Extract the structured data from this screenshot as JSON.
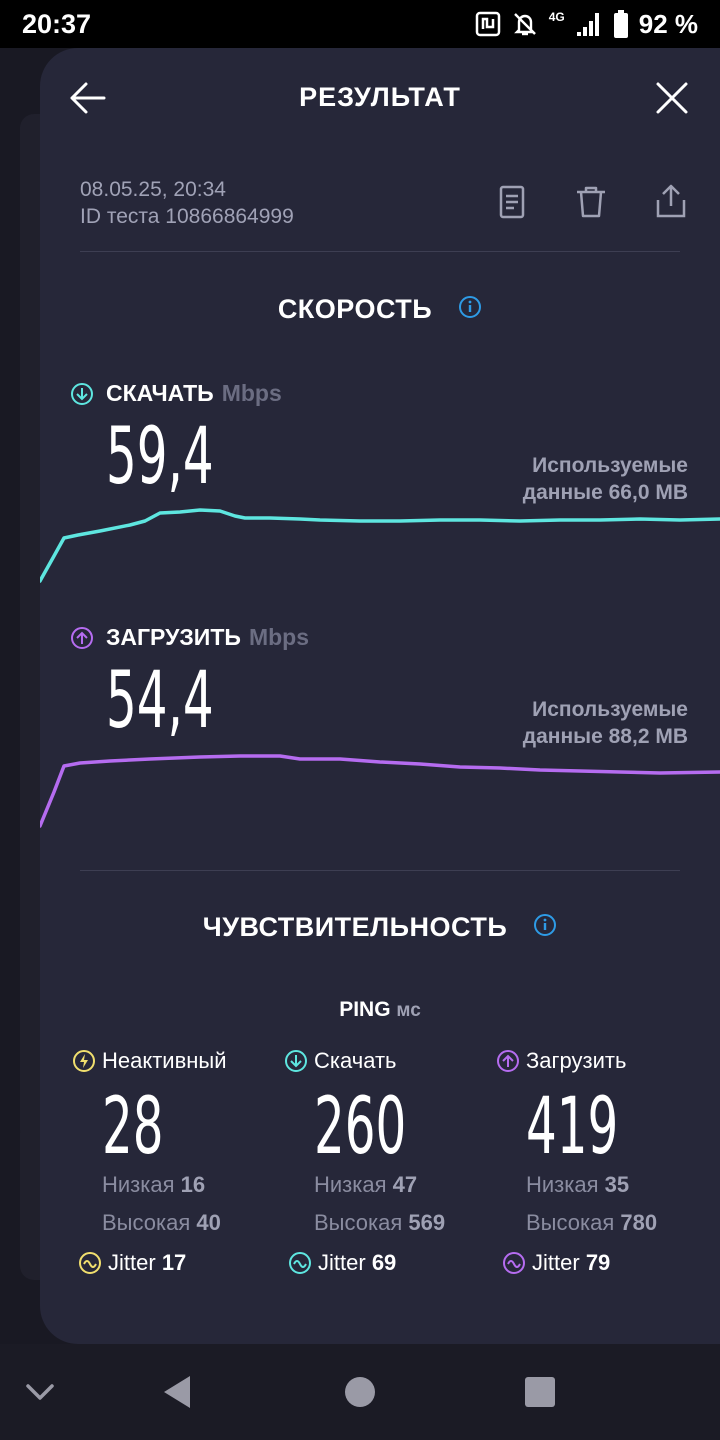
{
  "status_bar": {
    "time": "20:37",
    "network": "4G",
    "battery": "92 %"
  },
  "header": {
    "title": "РЕЗУЛЬТАТ"
  },
  "meta": {
    "datetime": "08.05.25, 20:34",
    "test_id": "ID теста 10866864999"
  },
  "speed": {
    "title": "СКОРОСТЬ",
    "download": {
      "label": "СКАЧАТЬ",
      "unit": "Mbps",
      "value": "59,4",
      "used_line1": "Используемые",
      "used_line2": "данные 66,0 MB"
    },
    "upload": {
      "label": "ЗАГРУЗИТЬ",
      "unit": "Mbps",
      "value": "54,4",
      "used_line1": "Используемые",
      "used_line2": "данные 88,2 MB"
    }
  },
  "latency": {
    "title": "ЧУВСТВИТЕЛЬНОСТЬ",
    "ping_label": "PING",
    "ping_unit": "мс",
    "idle": {
      "label": "Неактивный",
      "value": "28",
      "low_label": "Низкая",
      "low": "16",
      "high_label": "Высокая",
      "high": "40",
      "jitter_label": "Jitter",
      "jitter": "17"
    },
    "download": {
      "label": "Скачать",
      "value": "260",
      "low_label": "Низкая",
      "low": "47",
      "high_label": "Высокая",
      "high": "569",
      "jitter_label": "Jitter",
      "jitter": "69"
    },
    "upload": {
      "label": "Загрузить",
      "value": "419",
      "low_label": "Низкая",
      "low": "35",
      "high_label": "Высокая",
      "high": "780",
      "jitter_label": "Jitter",
      "jitter": "79"
    }
  },
  "colors": {
    "download": "#5ee6e0",
    "upload": "#b56cf0",
    "idle": "#f1df6e",
    "info": "#2e9be6",
    "sheet": "#262739"
  },
  "icons": [
    "back-arrow-icon",
    "close-icon",
    "document-icon",
    "trash-icon",
    "share-icon",
    "info-icon",
    "download-arrow-icon",
    "upload-arrow-icon",
    "idle-icon",
    "jitter-icon"
  ]
}
